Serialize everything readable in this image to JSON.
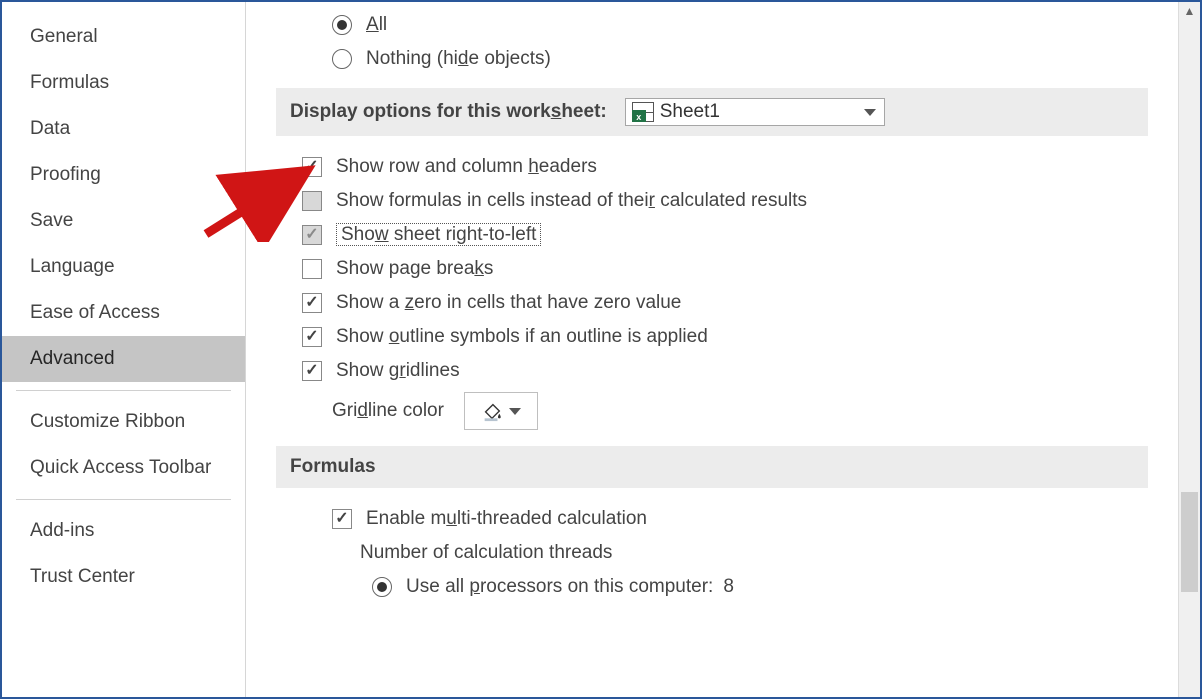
{
  "sidebar": {
    "items": [
      {
        "label": "General"
      },
      {
        "label": "Formulas"
      },
      {
        "label": "Data"
      },
      {
        "label": "Proofing"
      },
      {
        "label": "Save"
      },
      {
        "label": "Language"
      },
      {
        "label": "Ease of Access"
      },
      {
        "label": "Advanced"
      },
      {
        "label": "Customize Ribbon"
      },
      {
        "label": "Quick Access Toolbar"
      },
      {
        "label": "Add-ins"
      },
      {
        "label": "Trust Center"
      }
    ],
    "selected": "Advanced"
  },
  "topRadios": {
    "all": "All",
    "nothing": "Nothing (hide objects)"
  },
  "worksheetSection": {
    "title": "Display options for this worksheet:",
    "sheet": "Sheet1",
    "options": [
      {
        "label_pre": "Show row and column ",
        "hot": "h",
        "label_post": "eaders",
        "checked": true
      },
      {
        "label_pre": "Show formulas in cells instead of thei",
        "hot": "r",
        "label_post": " calculated results",
        "checked": false,
        "gray": true
      },
      {
        "label_pre": "Sho",
        "hot": "w",
        "label_post": " sheet right-to-left",
        "checked": true,
        "gray": true,
        "focus": true
      },
      {
        "label_pre": "Show page brea",
        "hot": "k",
        "label_post": "s",
        "checked": false
      },
      {
        "label_pre": "Show a ",
        "hot": "z",
        "label_post": "ero in cells that have zero value",
        "checked": true
      },
      {
        "label_pre": "Show ",
        "hot": "o",
        "label_post": "utline symbols if an outline is applied",
        "checked": true
      },
      {
        "label_pre": "Show g",
        "hot": "r",
        "label_post": "idlines",
        "checked": true
      }
    ],
    "gridlineColor": "Gridline color"
  },
  "formulasSection": {
    "title": "Formulas",
    "enableMulti": "Enable multi-threaded calculation",
    "threadsLabel": "Number of calculation threads",
    "useAll_pre": "Use all ",
    "useAll_hot": "p",
    "useAll_post": "rocessors on this computer:",
    "threadCount": "8"
  }
}
